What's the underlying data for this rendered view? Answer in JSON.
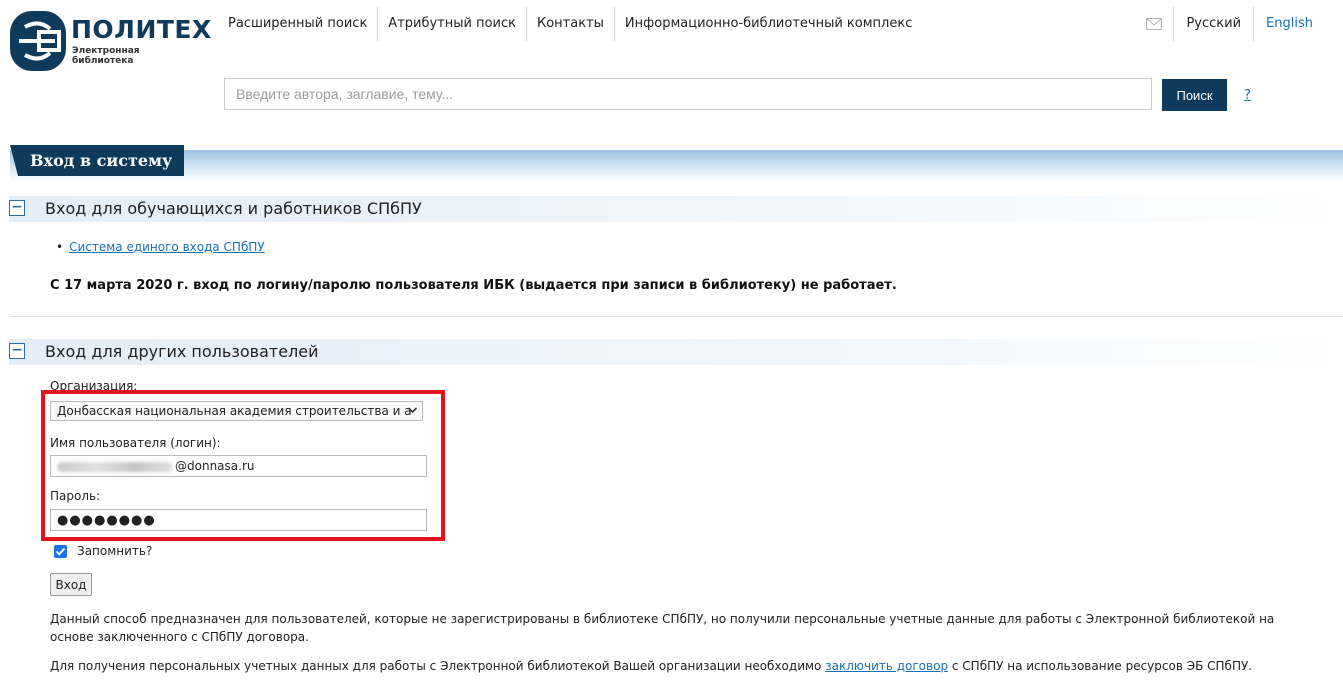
{
  "brand": {
    "name": "ПОЛИТЕХ",
    "subtitle": "Электронная библиотека"
  },
  "nav": {
    "items": [
      "Расширенный поиск",
      "Атрибутный поиск",
      "Контакты",
      "Информационно-библиотечный комплекс"
    ]
  },
  "languages": {
    "ru": "Русский",
    "en": "English"
  },
  "search": {
    "placeholder": "Введите автора, заглавие, тему...",
    "button": "Поиск",
    "help": "?"
  },
  "page": {
    "title": "Вход в систему"
  },
  "sections": {
    "staff": {
      "title": "Вход для обучающихся и работников СПбПУ",
      "toggle": "−",
      "sso_link": "Система единого входа СПбПУ",
      "notice": "С 17 марта 2020 г. вход по логину/паролю пользователя ИБК (выдается при записи в библиотеку) не работает."
    },
    "others": {
      "title": "Вход для других пользователей",
      "toggle": "−"
    }
  },
  "form": {
    "org_label": "Организация:",
    "org_value": "Донбасская национальная академия строительства и а",
    "username_label": "Имя пользователя (логин):",
    "username_suffix": "@donnasa.ru",
    "password_label": "Пароль:",
    "password_value": "●●●●●●●●",
    "remember_label": "Запомнить?",
    "remember_checked": true,
    "submit": "Вход"
  },
  "info": {
    "line1": "Данный способ предназначен для пользователей, которые не зарегистрированы в библиотеке СПбПУ, но получили персональные учетные данные для работы с Электронной библиотекой на",
    "line2": "основе заключенного с СПбПУ договора.",
    "line3_before": "Для получения персональных учетных данных для работы с Электронной библиотекой Вашей организации необходимо ",
    "line3_link": "заключить договор",
    "line3_after": " с СПбПУ на использование ресурсов ЭБ СПбПУ."
  },
  "colors": {
    "brand_navy": "#0e3a5c",
    "link": "#1a6fb3",
    "highlight": "#e1141b",
    "checkbox": "#1a73e8"
  },
  "icons": {
    "logo": "politech-logo",
    "mail": "mail-icon",
    "dropdown": "chevron-down-icon",
    "check": "check-icon"
  }
}
